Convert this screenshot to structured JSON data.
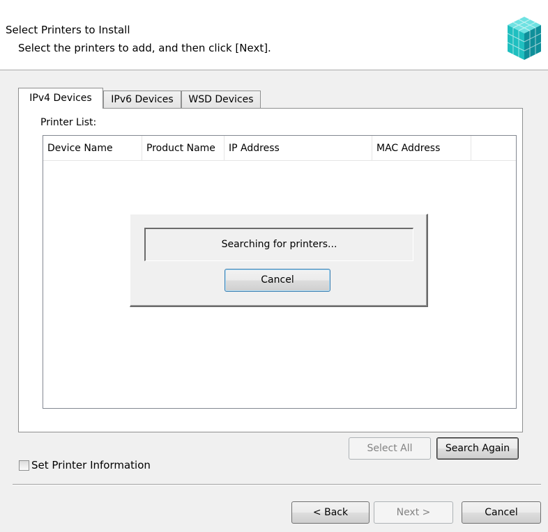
{
  "header": {
    "title": "Select Printers to Install",
    "subtitle": "Select the printers to add, and then click [Next].",
    "logo_icon": "printer-cube-icon"
  },
  "tabs": [
    {
      "label": "IPv4 Devices",
      "active": true
    },
    {
      "label": "IPv6 Devices",
      "active": false
    },
    {
      "label": "WSD Devices",
      "active": false
    }
  ],
  "printer_list": {
    "label": "Printer List:",
    "columns": [
      "Device Name",
      "Product Name",
      "IP Address",
      "MAC Address",
      ""
    ]
  },
  "search_dialog": {
    "status": "Searching for printers...",
    "cancel_label": "Cancel"
  },
  "list_buttons": {
    "select_all": "Select All",
    "search_again": "Search Again"
  },
  "set_printer_info": {
    "label": "Set Printer Information",
    "checked": false
  },
  "footer": {
    "back": "< Back",
    "next": "Next >",
    "cancel": "Cancel"
  },
  "colors": {
    "background": "#f0f0f0",
    "header_bg": "#ffffff",
    "logo_teal": "#1fbfc0",
    "disabled_text": "#838383"
  }
}
